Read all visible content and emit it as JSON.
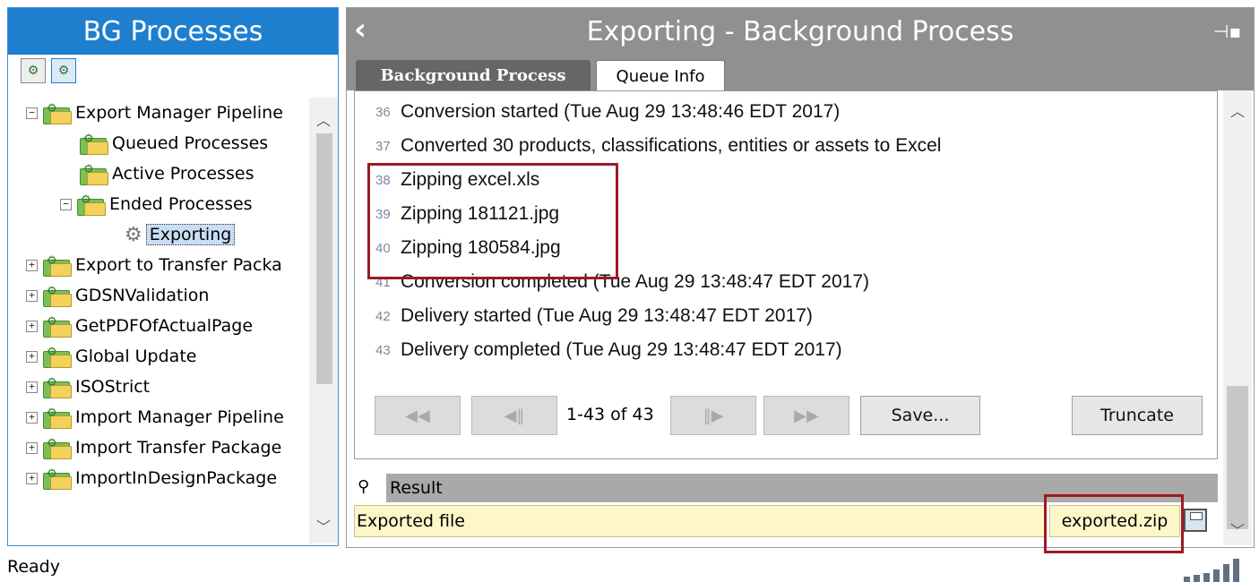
{
  "left_panel": {
    "title": "BG Processes",
    "tree": [
      {
        "label": "Export Manager Pipeline",
        "expander": "−"
      },
      {
        "label": "Queued Processes"
      },
      {
        "label": "Active Processes"
      },
      {
        "label": "Ended Processes",
        "expander": "−"
      },
      {
        "label": "Exporting",
        "selected": true
      },
      {
        "label": "Export to Transfer Packa",
        "expander": "+"
      },
      {
        "label": "GDSNValidation",
        "expander": "+"
      },
      {
        "label": "GetPDFOfActualPage",
        "expander": "+"
      },
      {
        "label": "Global Update",
        "expander": "+"
      },
      {
        "label": "ISOStrict",
        "expander": "+"
      },
      {
        "label": "Import Manager Pipeline",
        "expander": "+"
      },
      {
        "label": "Import Transfer Package",
        "expander": "+"
      },
      {
        "label": "ImportInDesignPackage",
        "expander": "+"
      }
    ]
  },
  "right_panel": {
    "title": "Exporting  - Background Process",
    "tabs": [
      {
        "label": "Background Process",
        "active": true
      },
      {
        "label": "Queue Info",
        "active": false
      }
    ],
    "log": [
      {
        "num": "36",
        "text": "Conversion started (Tue Aug 29 13:48:46 EDT 2017)"
      },
      {
        "num": "37",
        "text": "Converted 30 products, classifications, entities or assets to Excel"
      },
      {
        "num": "38",
        "text": "Zipping excel.xls"
      },
      {
        "num": "39",
        "text": "Zipping 181121.jpg"
      },
      {
        "num": "40",
        "text": "Zipping 180584.jpg"
      },
      {
        "num": "41",
        "text": "Conversion completed (Tue Aug 29 13:48:47 EDT 2017)"
      },
      {
        "num": "42",
        "text": "Delivery started (Tue Aug 29 13:48:47 EDT 2017)"
      },
      {
        "num": "43",
        "text": "Delivery completed (Tue Aug 29 13:48:47 EDT 2017)"
      }
    ],
    "pager": {
      "first": "◀◀",
      "prev": "◀‖",
      "range": "1-43 of 43",
      "next": "‖▶",
      "last": "▶▶",
      "save": "Save...",
      "truncate": "Truncate"
    },
    "result": {
      "label": "Result",
      "file_label": "Exported file",
      "file_value": "exported.zip"
    }
  },
  "status": {
    "text": "Ready",
    "signal_bars": 6
  },
  "colors": {
    "left_title_bg": "#1e7fcf",
    "right_title_bg": "#909090",
    "highlight": "#9b1b24",
    "file_bg": "#fdf6c8"
  }
}
